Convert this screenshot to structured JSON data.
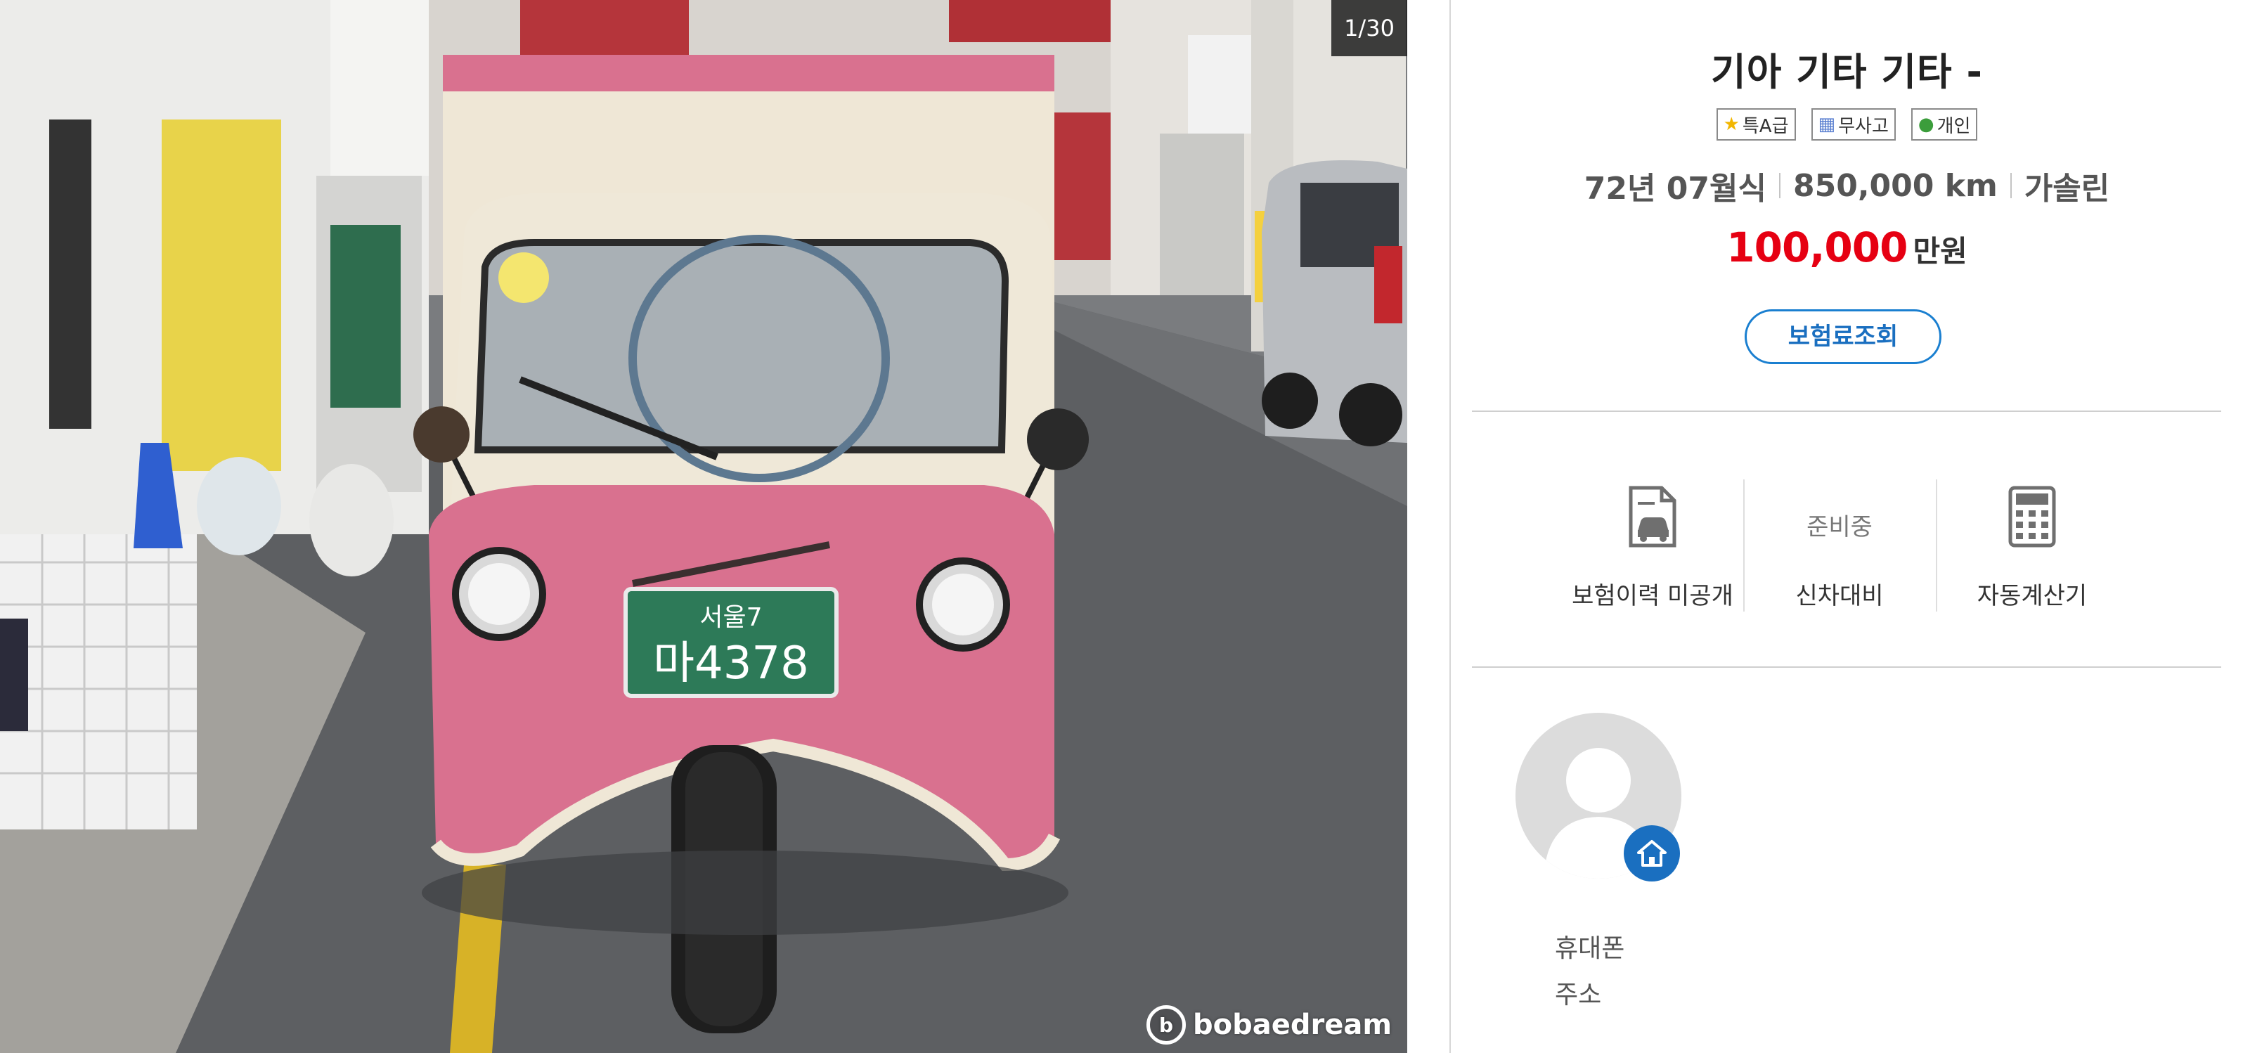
{
  "gallery": {
    "counter": "1/30",
    "watermark": "bobaedream",
    "photo_plate_top": "서울7",
    "photo_plate_main": "마4378"
  },
  "listing": {
    "title": "기아 기타 기타 -",
    "badges": [
      {
        "label": "특A급",
        "icon": "star-icon"
      },
      {
        "label": "무사고",
        "icon": "no-accident-icon"
      },
      {
        "label": "개인",
        "icon": "person-icon"
      }
    ],
    "specs": {
      "year": "72년 07월식",
      "mileage": "850,000 km",
      "fuel": "가솔린"
    },
    "price": {
      "amount": "100,000",
      "unit": "만원"
    },
    "insurance_button": "보험료조회"
  },
  "tools": [
    {
      "label": "보험이력 미공개",
      "icon": "insurance-document-icon"
    },
    {
      "label": "신차대비",
      "status": "준비중"
    },
    {
      "label": "자동계산기",
      "icon": "calculator-icon"
    }
  ],
  "seller": {
    "phone_label": "휴대폰",
    "address_label": "주소"
  },
  "colors": {
    "price": "#e60012",
    "accent": "#1a6fc0",
    "truck_pink": "#d9718f",
    "truck_cream": "#efe7d6",
    "plate_green": "#2d7a58"
  }
}
